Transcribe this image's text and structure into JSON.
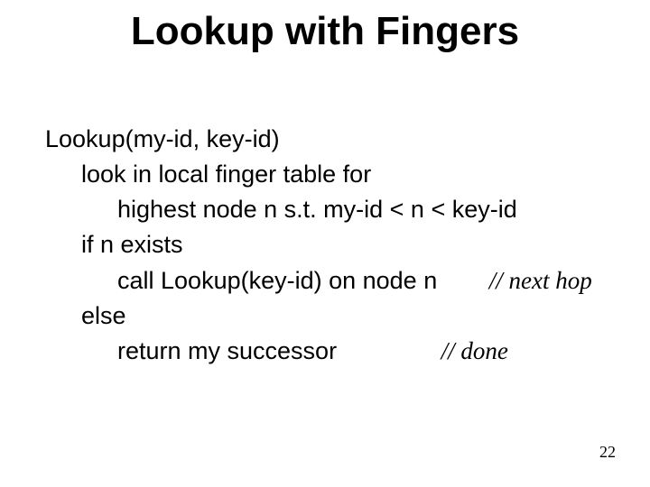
{
  "title": "Lookup with Fingers",
  "code": {
    "l1": "Lookup(my-id, key-id)",
    "l2": "look in local finger table for",
    "l3": "highest node n s.t. my-id < n < key-id",
    "l4": "if n exists",
    "l5": "call Lookup(key-id) on node n",
    "l5_comment": "// next hop",
    "l6": "else",
    "l7": "return my successor",
    "l7_comment": "// done"
  },
  "page_number": "22"
}
